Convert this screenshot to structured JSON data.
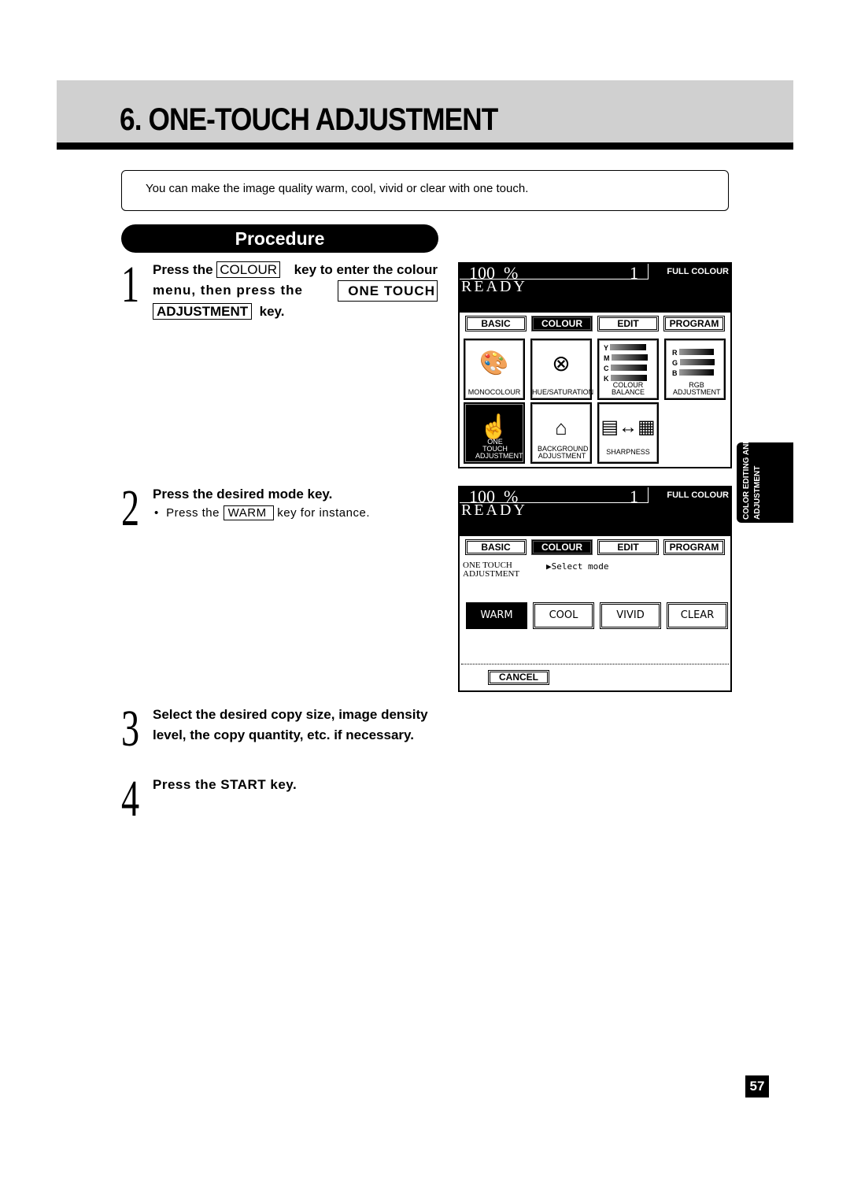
{
  "header": {
    "title": "6. ONE-TOUCH ADJUSTMENT"
  },
  "intro": "You can make the image quality warm, cool, vivid or clear with one touch.",
  "procedure_label": "Procedure",
  "steps": [
    {
      "num": "1",
      "pre": "Press the",
      "key1": "COLOUR",
      "mid": "key to enter the colour",
      "line2": "menu, then press the",
      "key2a": "ONE TOUCH",
      "key2b": "ADJUSTMENT",
      "post": "key."
    },
    {
      "num": "2",
      "text": "Press the desired mode key.",
      "bullet": "•",
      "sub_pre": "Press the",
      "sub_key": "WARM",
      "sub_post": "key for instance."
    },
    {
      "num": "3",
      "line1": "Select the desired copy size, image density",
      "line2": "level, the copy quantity, etc. if necessary."
    },
    {
      "num": "4",
      "text": "Press the START key."
    }
  ],
  "screen1": {
    "zoom": "100",
    "percent": "%",
    "count": "1",
    "mode": "FULL COLOUR",
    "status": "READY",
    "tabs": [
      "BASIC",
      "COLOUR",
      "EDIT",
      "PROGRAM"
    ],
    "active_tab": "COLOUR",
    "icons": [
      {
        "label": "MONOCOLOUR",
        "icon": "palette-icon"
      },
      {
        "label": "HUE/SATURATION",
        "icon": "colour-wheel-icon"
      },
      {
        "label": "COLOUR BALANCE",
        "icon": "ymck-bars-icon"
      },
      {
        "label": "RGB ADJUSTMENT",
        "icon": "rgb-bars-icon"
      },
      {
        "label": "ONE TOUCH ADJUSTMENT",
        "icon": "hand-press-icon"
      },
      {
        "label": "BACKGROUND ADJUSTMENT",
        "icon": "house-document-icon"
      },
      {
        "label": "SHARPNESS",
        "icon": "sharpness-icon"
      }
    ],
    "ymck": [
      "Y",
      "M",
      "C",
      "K"
    ],
    "rgb": [
      "R",
      "G",
      "B"
    ]
  },
  "screen2": {
    "zoom": "100",
    "percent": "%",
    "count": "1",
    "mode": "FULL COLOUR",
    "status": "READY",
    "tabs": [
      "BASIC",
      "COLOUR",
      "EDIT",
      "PROGRAM"
    ],
    "active_tab": "COLOUR",
    "heading1": "ONE TOUCH",
    "heading2": "ADJUSTMENT",
    "prompt": "▶Select mode",
    "modes": [
      "WARM",
      "COOL",
      "VIVID",
      "CLEAR"
    ],
    "selected_mode": "WARM",
    "cancel": "CANCEL"
  },
  "side_tab": {
    "line1": "COLOR EDITING AND",
    "line2": "ADJUSTMENT"
  },
  "page_number": "57"
}
